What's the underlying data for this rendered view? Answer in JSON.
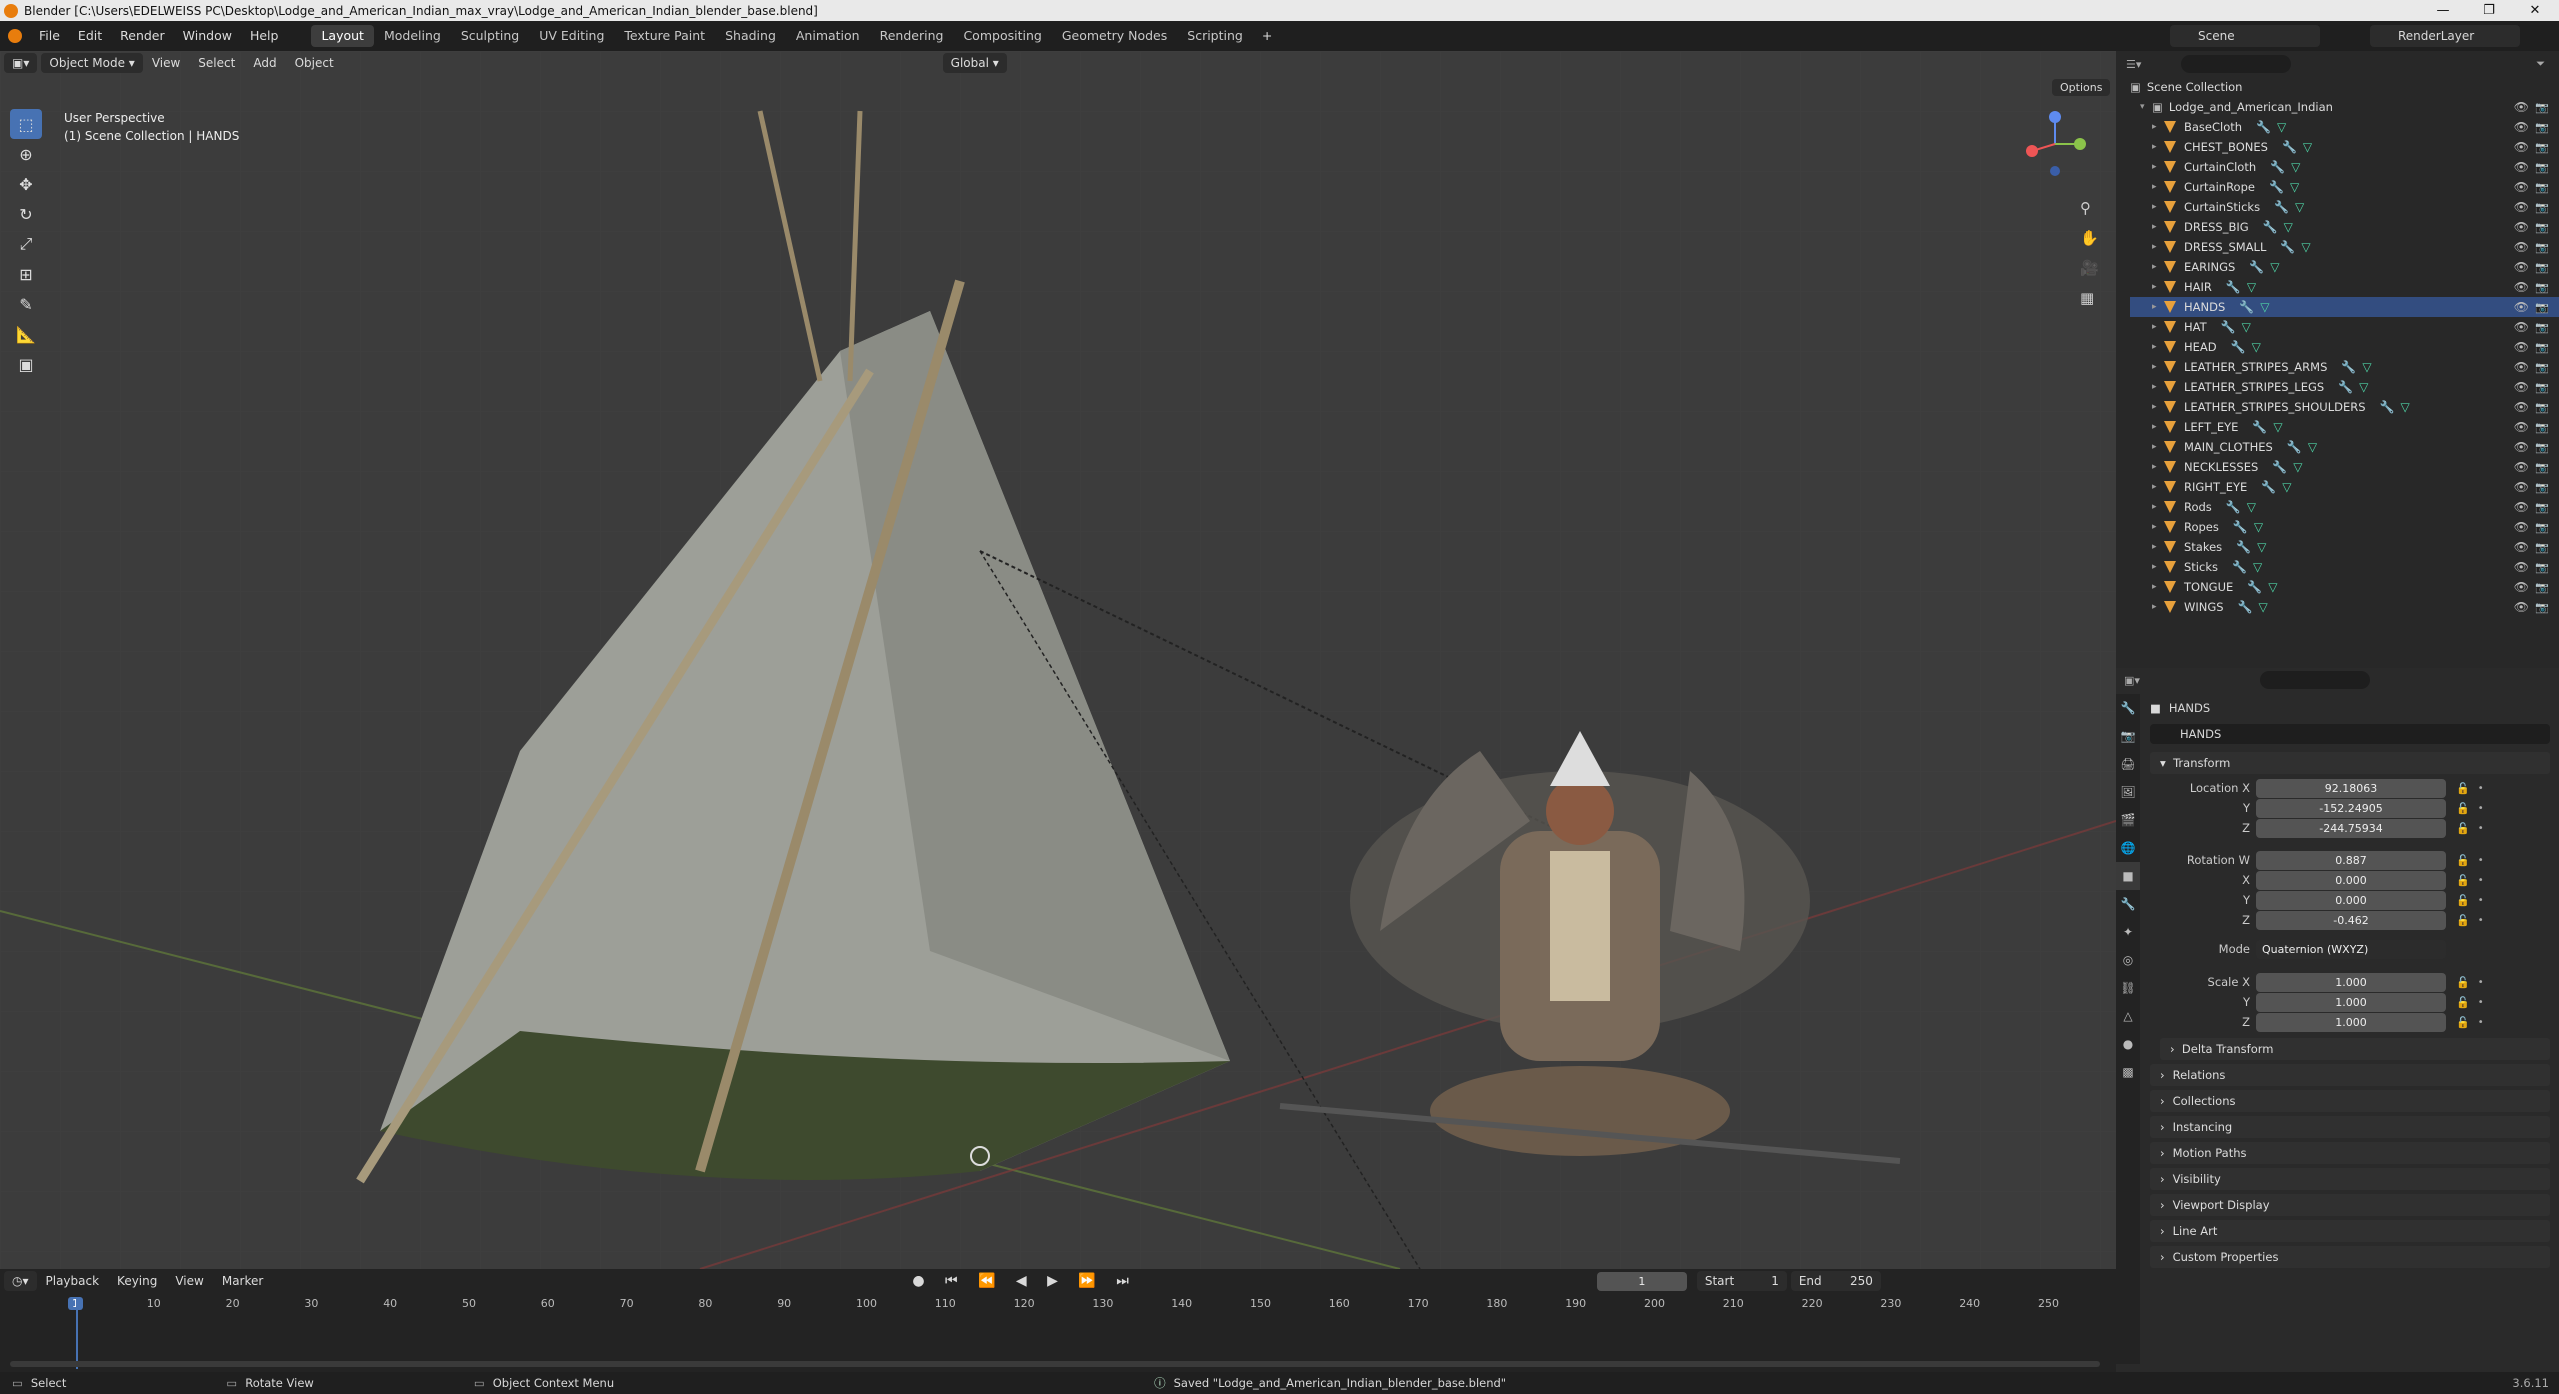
{
  "window": {
    "title": "Blender [C:\\Users\\EDELWEISS PC\\Desktop\\Lodge_and_American_Indian_max_vray\\Lodge_and_American_Indian_blender_base.blend]"
  },
  "menus": [
    "File",
    "Edit",
    "Render",
    "Window",
    "Help"
  ],
  "workspaces": [
    "Layout",
    "Modeling",
    "Sculpting",
    "UV Editing",
    "Texture Paint",
    "Shading",
    "Animation",
    "Rendering",
    "Compositing",
    "Geometry Nodes",
    "Scripting"
  ],
  "scene": {
    "name": "Scene",
    "render_layer": "RenderLayer"
  },
  "viewport": {
    "mode": "Object Mode",
    "menus": [
      "View",
      "Select",
      "Add",
      "Object"
    ],
    "orientation": "Global",
    "options": "Options",
    "perspective": "User Perspective",
    "collection_info": "(1) Scene Collection | HANDS"
  },
  "outliner": {
    "root": "Scene Collection",
    "collection": "Lodge_and_American_Indian",
    "items": [
      "BaseCloth",
      "CHEST_BONES",
      "CurtainCloth",
      "CurtainRope",
      "CurtainSticks",
      "DRESS_BIG",
      "DRESS_SMALL",
      "EARINGS",
      "HAIR",
      "HANDS",
      "HAT",
      "HEAD",
      "LEATHER_STRIPES_ARMS",
      "LEATHER_STRIPES_LEGS",
      "LEATHER_STRIPES_SHOULDERS",
      "LEFT_EYE",
      "MAIN_CLOTHES",
      "NECKLESSES",
      "RIGHT_EYE",
      "Rods",
      "Ropes",
      "Stakes",
      "Sticks",
      "TONGUE",
      "WINGS"
    ],
    "selected": "HANDS"
  },
  "properties": {
    "object": "HANDS",
    "name_field": "HANDS",
    "transform": "Transform",
    "location_label": "Location X",
    "loc": {
      "x": "92.18063",
      "y": "-152.24905",
      "z": "-244.75934"
    },
    "rotation_label": "Rotation W",
    "rot": {
      "w": "0.887",
      "x": "0.000",
      "y": "0.000",
      "z": "-0.462"
    },
    "mode_label": "Mode",
    "mode": "Quaternion (WXYZ)",
    "scale_label": "Scale X",
    "scale": {
      "x": "1.000",
      "y": "1.000",
      "z": "1.000"
    },
    "axis": {
      "y": "Y",
      "z": "Z",
      "x": "X"
    },
    "delta": "Delta Transform",
    "panels": [
      "Relations",
      "Collections",
      "Instancing",
      "Motion Paths",
      "Visibility",
      "Viewport Display",
      "Line Art",
      "Custom Properties"
    ]
  },
  "timeline": {
    "menus": [
      "Playback",
      "Keying",
      "View",
      "Marker"
    ],
    "frame": "1",
    "start_label": "Start",
    "start": "1",
    "end_label": "End",
    "end": "250",
    "ticks": [
      "1",
      "10",
      "20",
      "30",
      "40",
      "50",
      "60",
      "70",
      "80",
      "90",
      "100",
      "110",
      "120",
      "130",
      "140",
      "150",
      "160",
      "170",
      "180",
      "190",
      "200",
      "210",
      "220",
      "230",
      "240",
      "250"
    ]
  },
  "status": {
    "select": "Select",
    "rotate": "Rotate View",
    "context": "Object Context Menu",
    "saved": "Saved \"Lodge_and_American_Indian_blender_base.blend\"",
    "version": "3.6.11"
  }
}
